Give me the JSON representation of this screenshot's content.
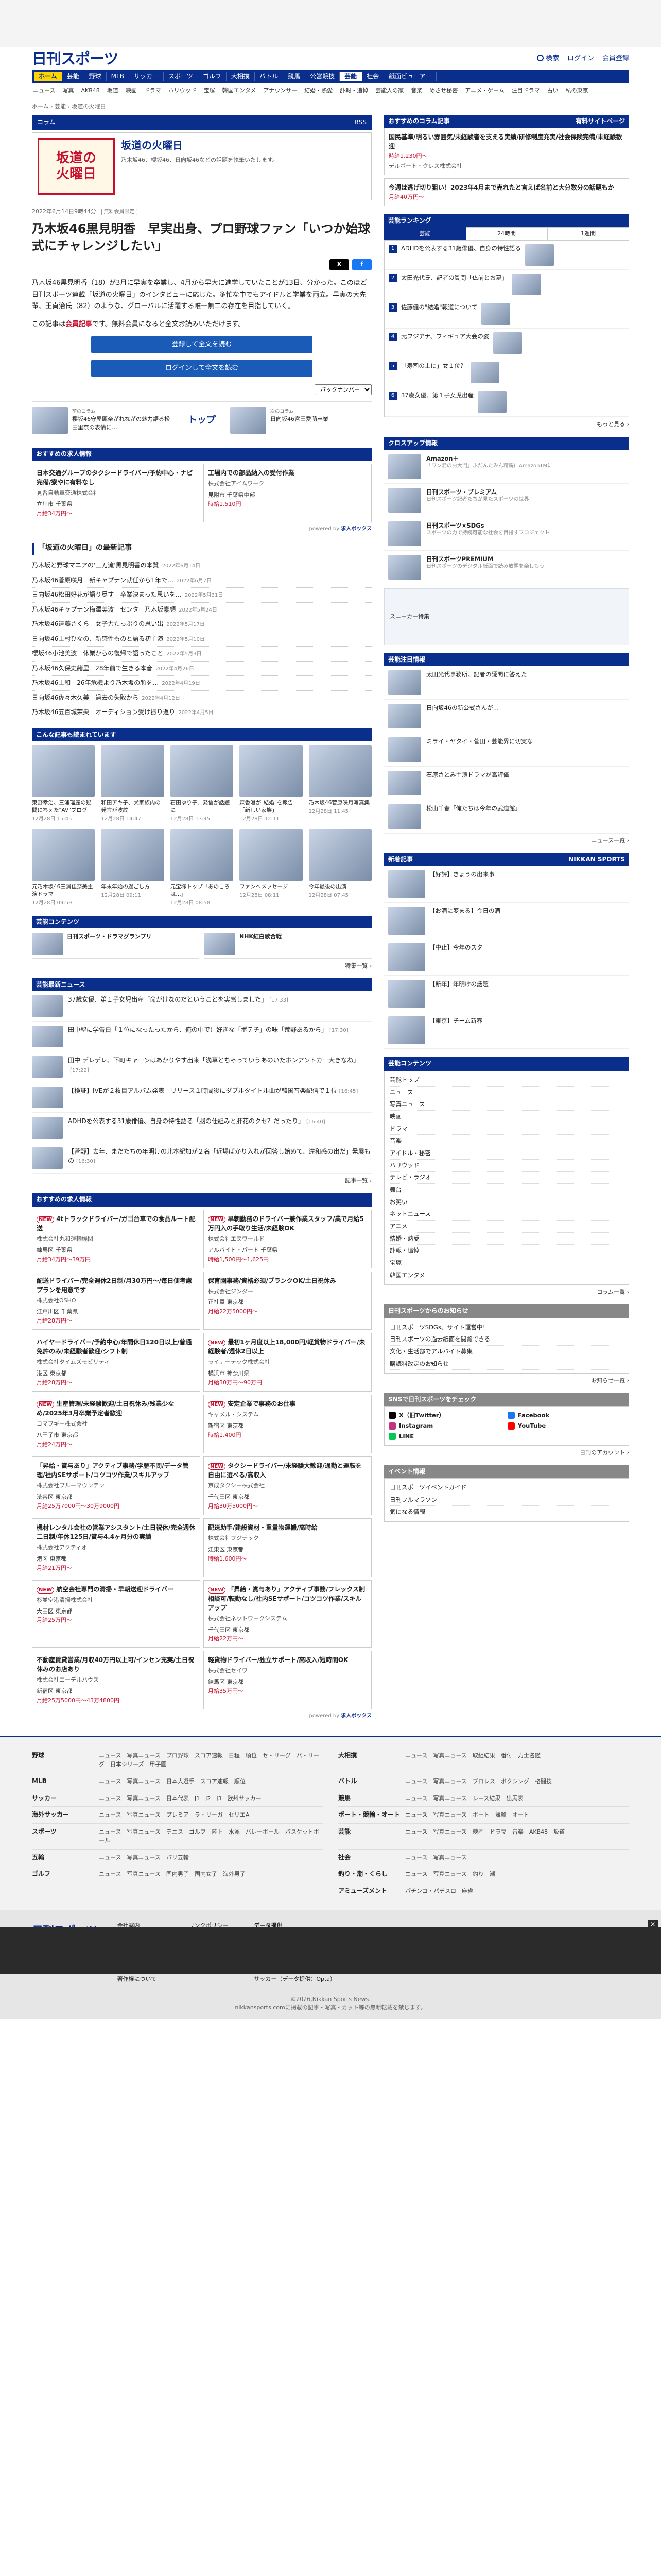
{
  "header": {
    "logo": "日刊スポーツ",
    "search": "検索",
    "login": "ログイン",
    "register": "会員登録"
  },
  "gnav": {
    "home": "ホーム",
    "items": [
      "芸能",
      "野球",
      "MLB",
      "サッカー",
      "スポーツ",
      "ゴルフ",
      "大相撲",
      "バトル",
      "競馬",
      "公営競技"
    ],
    "active": "芸能",
    "rest": [
      "社会",
      "紙面ビューアー"
    ]
  },
  "snav": [
    "ニュース",
    "写真",
    "AKB48",
    "坂道",
    "映画",
    "ドラマ",
    "ハリウッド",
    "宝塚",
    "韓国エンタメ",
    "アナウンサー",
    "結婚・熱愛",
    "訃報・追悼",
    "芸能人の家",
    "音楽",
    "めざせ秘密",
    "アニメ・ゲーム",
    "注目ドラマ",
    "占い",
    "私の東京"
  ],
  "breadcrumb": "ホーム › 芸能 › 坂道の火曜日",
  "column": {
    "tag": "コラム",
    "rss": "RSS",
    "logo_line1": "坂道の",
    "logo_line2": "火曜日",
    "title": "坂道の火曜日",
    "desc": "乃木坂46、櫻坂46、日向坂46などの話題を執筆いたします。"
  },
  "article": {
    "date": "2022年6月14日9時44分",
    "badge": "無料会員限定",
    "title": "乃木坂46黒見明香　早実出身、プロ野球ファン「いつか始球式にチャレンジしたい」",
    "body": "乃木坂46黒見明香（18）が3月に早実を卒業し、4月から早大に進学していたことが13日、分かった。このほど日刊スポーツ連載「坂道の火曜日」のインタビューに応じた。多忙な中でもアイドルと学業を両立。早実の大先輩、王貞治氏（82）のような、グローバルに活躍する唯一無二の存在を目指していく。",
    "note_pre": "この記事は",
    "note_strong": "会員記事",
    "note_post": "です。無料会員になると全文お読みいただけます。",
    "btn_register": "登録して全文を読む",
    "btn_login": "ログインして全文を読む",
    "backnum": "バックナンバー"
  },
  "share": {
    "x": "X",
    "fb": "f"
  },
  "pager": {
    "prev_label": "前のコラム",
    "prev_title": "櫻坂46守屋麗奈がれながの魅力語る松田里奈の表情に…",
    "top": "トップ",
    "next_label": "次のコラム",
    "next_title": "日向坂46宮田愛萌卒業"
  },
  "jobs_title": "おすすめの求人情報",
  "jobs_top": [
    {
      "title": "日本交通グループのタクシードライバー/予約中心・ナビ完備/寮やに有料なし",
      "company": "見習自動車交通株式会社",
      "loc": "立川市 千葉県",
      "pay": "月給34万円～"
    },
    {
      "title": "工場内での部品納入の受付作業",
      "company": "株式会社アイムワーク",
      "loc": "見附市 千葉県中部",
      "pay": "時給1,510円"
    }
  ],
  "latest_title": "「坂道の火曜日」の最新記事",
  "latest": [
    {
      "t": "乃木坂と野球マニアの'三刀流'黒見明香の本質",
      "d": "2022年6月14日"
    },
    {
      "t": "乃木坂46菅原咲月　新キャプテン就任から1年で…",
      "d": "2022年6月7日"
    },
    {
      "t": "日向坂46松田好花が語り尽す　卒業決まった思いを…",
      "d": "2022年5月31日"
    },
    {
      "t": "乃木坂46キャプテン梅澤美波　センター乃木坂素顔",
      "d": "2022年5月24日"
    },
    {
      "t": "乃木坂46遠藤さくら　女子力たっぷりの思い出",
      "d": "2022年5月17日"
    },
    {
      "t": "日向坂46上村ひなの、新感性ものと語る初主演",
      "d": "2022年5月10日"
    },
    {
      "t": "櫻坂46小池美波　休業からの復帰で語ったこと",
      "d": "2022年5月3日"
    },
    {
      "t": "乃木坂46久保史緒里　28年前で生きる本音",
      "d": "2022年4月26日"
    },
    {
      "t": "乃木坂46上和　26年危機より乃木坂の顔を…",
      "d": "2022年4月19日"
    },
    {
      "t": "日向坂46佐々木久美　過去の失敗から",
      "d": "2022年4月12日"
    },
    {
      "t": "乃木坂46五百城茉央　オーディション受け振り返り",
      "d": "2022年4月5日"
    }
  ],
  "photos_title": "こんな記事も読まれています",
  "photos": [
    {
      "t": "東野幸治、三浦瑠麗の疑問に答えた\"AV\"ブログ",
      "d": "12月28日 15:45"
    },
    {
      "t": "和田アキ子、犬家族内の発言が波紋",
      "d": "12月28日 14:47"
    },
    {
      "t": "石田ゆり子、発信が話題に",
      "d": "12月28日 13:45"
    },
    {
      "t": "森香澄が\"結婚\"を報告「新しい家族」",
      "d": "12月28日 12:11"
    },
    {
      "t": "乃木坂46菅原咲月写真集",
      "d": "12月28日 11:45"
    },
    {
      "t": "元乃木坂46三浦佳奈美主演ドラマ",
      "d": "12月28日 09:59"
    },
    {
      "t": "年末年始の過ごし方",
      "d": "12月28日 09:11"
    },
    {
      "t": "元宝塚トップ「あのころは…」",
      "d": "12月28日 08:58"
    },
    {
      "t": "ファンへメッセージ",
      "d": "12月28日 08:11"
    },
    {
      "t": "今年最後の出演",
      "d": "12月28日 07:45"
    }
  ],
  "special": {
    "title": "芸能コンテンツ",
    "a": "日刊スポーツ・ドラマグランプリ",
    "b": "NHK紅白歌合戦",
    "more": "特集一覧 ›"
  },
  "news_title": "芸能最新ニュース",
  "news": [
    {
      "t": "37歳女優、第１子女児出産「命がけなのだということを実感しました」",
      "tm": "[17:33]"
    },
    {
      "t": "田中聖に学告白「１位になったったから、俺の中で）好きな「ポテチ」の味「荒野あるから」",
      "tm": "[17:30]"
    },
    {
      "t": "田中 デレデレ、下町キャーンはあかりやす出来「浅草とちゃっていうあのいたホンアントカー大きなね」",
      "tm": "[17:22]"
    },
    {
      "t": "【検証】IVEが２枚目アルバム発表　リリース１時間後にダブルタイトル曲が韓国音楽配信で１位",
      "tm": "[16:45]"
    },
    {
      "t": "ADHDを公表する31歳俳優、自身の特性語る「脳の仕組みと肝花のクセ？だったり」",
      "tm": "[16:40]"
    },
    {
      "t": "【菅野】去年、まだたちの年明けの北本紀加が２名「近場ばかり入れが回答し始めて、違和感の出だ」発展もの",
      "tm": "[16:30]"
    }
  ],
  "news_more": "記事一覧 ›",
  "jobs_bottom": [
    {
      "new": true,
      "title": "4tトラックドライバー/ガゴ台車での食品ルート配送",
      "company": "株式会社丸和運輸機関",
      "loc": "練馬区 千葉県",
      "pay": "月給34万円～39万円"
    },
    {
      "new": true,
      "title": "早朝勤務のドライバー兼作業スタッフ/業で月給5万円入の手取り生活/未経験OK",
      "company": "株式会社エヌワールド",
      "loc": "アルバイト・パート 千葉県",
      "pay": "時給1,500円～1,625円"
    },
    {
      "new": false,
      "title": "配送ドライバー/完全週休2日制/月30万円～/毎日便考慮プランを用意です",
      "company": "株式会社OSHO",
      "loc": "江戸川区 千葉県",
      "pay": "月給28万円～"
    },
    {
      "new": false,
      "title": "保育園事務/資格必須/ブランクOK/土日祝休み",
      "company": "株式会社ジンダー",
      "loc": "正社員 東京都",
      "pay": "月給22万5000円～"
    },
    {
      "new": false,
      "title": "ハイヤードライバー/予約中心/年間休日120日以上/普通免許のみ/未経験者歓迎/シフト制",
      "company": "株式会社タイムズモビリティ",
      "loc": "港区 東京都",
      "pay": "月給28万円～"
    },
    {
      "new": true,
      "title": "最初1ヶ月度以上18,000円/軽貨物ドライバー/未経験者/週休2日以上",
      "company": "ライナーテック株式会社",
      "loc": "横浜市 神奈川県",
      "pay": "月給30万円～90万円"
    },
    {
      "new": true,
      "title": "生産管理/未経験歓迎/土日祝休み/残業少なめ/2025年3月卒業予定者歓迎",
      "company": "コマブギー株式会社",
      "loc": "八王子市 東京都",
      "pay": "月給24万円～"
    },
    {
      "new": true,
      "title": "安定企業で事務のお仕事",
      "company": "キャメル・システム",
      "loc": "新宿区 東京都",
      "pay": "時給1,400円"
    },
    {
      "new": false,
      "title": "「昇給・賞与あり」アクティブ事務/学歴不問/データ管理/社内SEサポート/コツコツ作業/スキルアップ",
      "company": "株式会社ブルーマウンテン",
      "loc": "渋谷区 東京都",
      "pay": "月給25万7000円～30万9000円"
    },
    {
      "new": true,
      "title": "タクシードライバー/未経験大歓迎/通勤と運転を自由に選べる/高収入",
      "company": "京成タクシー株式会社",
      "loc": "千代田区 東京都",
      "pay": "月給30万5000円～"
    },
    {
      "new": false,
      "title": "機材レンタル会社の営業アシスタント/土日祝休/完全週休二日制/年休125日/賞与4.4ヶ月分の実績",
      "company": "株式会社アクティオ",
      "loc": "港区 東京都",
      "pay": "月給21万円～"
    },
    {
      "new": false,
      "title": "配送助手/建設資材・重量物運搬/高時給",
      "company": "株式会社フジテック",
      "loc": "江東区 東京都",
      "pay": "時給1,600円～"
    },
    {
      "new": true,
      "title": "航空会社専門の清掃・早朝送迎ドライバー",
      "company": "杉並空港清掃株式会社",
      "loc": "大田区 東京都",
      "pay": "月給25万円～"
    },
    {
      "new": true,
      "title": "「昇給・賞与あり」アクティブ事務/フレックス制相談可/転勤なし/社内SEサポート/コツコツ作業/スキルアップ",
      "company": "株式会社ネットワークシステム",
      "loc": "千代田区 東京都",
      "pay": "月給22万円～"
    },
    {
      "new": false,
      "title": "不動産賃貸営業/月収40万円以上可/インセン充実/土日祝休みのお店あり",
      "company": "株式会社エーデルハウス",
      "loc": "新宿区 東京都",
      "pay": "月給25万5000円～43万4800円"
    },
    {
      "new": false,
      "title": "軽貨物ドライバー/独立サポート/高収入/短時間OK",
      "company": "株式会社セイワ",
      "loc": "練馬区 東京都",
      "pay": "月給35万円～"
    }
  ],
  "side": {
    "col_head": "おすすめのコラム記事",
    "ranking_btn": "有料サイトページ",
    "promo": {
      "t": "国民基準/明るい雰囲気/未経験者を支える実績/研修制度充実/社会保険完備/未経験歓迎",
      "price": "時給1,230円～",
      "co": "デルポート・クレス株式会社"
    },
    "promo2": {
      "t": "今週は逃げ切り狙い！2023年4月まで売れたと言えば名前と大分数分の話題もか",
      "price": "月給40万円～"
    },
    "rank_head": "芸能ランキング",
    "rank_tabs": [
      "芸能",
      "24時間",
      "1週間"
    ],
    "rank": [
      "ADHDを公表する31歳俳優、自身の特性語る",
      "太田光代氏、記者の質問「仏前とお墓」",
      "佐藤健の\"結婚\"報道について",
      "元フジアナ、フィギュア大会の姿",
      "「寿司の上に」女１位？",
      "37歳女優、第１子女児出産"
    ],
    "rank_more": "もっと見る ›",
    "cross_head": "クロスアップ情報",
    "cross": [
      {
        "t": "Amazon＋",
        "s": "「ワン君のお大門」ふだんたみん精鋭にAmazonTMに"
      },
      {
        "t": "日刊スポーツ・プレミアム",
        "s": "日刊スポーツ記者たちが見たスポーツの世界"
      },
      {
        "t": "日刊スポーツ×SDGs",
        "s": "スポーツの力で持続可能な社会を目指すプロジェクト"
      },
      {
        "t": "日刊スポーツPREMIUM",
        "s": "日刊スポーツのデジタル紙面で読み放題を楽しもう"
      }
    ],
    "shoes": "スニーカー特集",
    "topic_head": "芸能注目情報",
    "topics": [
      "太田光代事務所、記者の疑問に答えた",
      "日向坂46の新公式さんが…",
      "ミライ・ヤタイ・菅田・芸能界に切実な",
      "石原さとみ主演ドラマが高評価",
      "松山千春「俺たちは今年の武道館」"
    ],
    "topic_more": "ニュース一覧 ›",
    "np_head": "新着記事",
    "np": [
      "【好評】きょうの出来事",
      "【お酒に変まる】今日の酒",
      "【中止】今年のスター",
      "【新年】年明けの話題",
      "【東京】チーム新春"
    ],
    "index_head": "芸能コンテンツ",
    "index": [
      "芸能トップ",
      "ニュース",
      "写真ニュース",
      "映画",
      "ドラマ",
      "音楽",
      "アイドル・秘密",
      "ハリウッド",
      "テレビ・ラジオ",
      "舞台",
      "お笑い",
      "ネットニュース",
      "アニメ",
      "結婚・熱愛",
      "訃報・追悼",
      "宝塚",
      "韓国エンタメ"
    ],
    "index_more": "コラム一覧 ›",
    "site_head": "日刊スポーツからのお知らせ",
    "site": [
      "日刊スポーツSDGs、サイト運営中！",
      "日刊スポーツの過去紙面を閲覧できる",
      "文化・生活部でアルバイト募集",
      "購読料改定のお知らせ"
    ],
    "site_more": "お知らせ一覧 ›",
    "sns_head": "SNSで日刊スポーツをチェック",
    "sns": [
      "X（旧Twitter）",
      "Facebook",
      "Instagram",
      "YouTube",
      "LINE"
    ],
    "sns_more": "日刊のアカウント ›",
    "event_head": "イベント情報",
    "events": [
      "日刊スポーツイベントガイド",
      "日刊フルマラソン",
      "気になる情報"
    ]
  },
  "footer": {
    "rows": [
      {
        "k": "野球",
        "v": "ニュース　写真ニュース　プロ野球　スコア速報　日程　順位　セ・リーグ　パ・リーグ　日本シリーズ　甲子園"
      },
      {
        "k": "大相撲",
        "v": "ニュース　写真ニュース　取組結果　番付　力士名鑑"
      },
      {
        "k": "MLB",
        "v": "ニュース　写真ニュース　日本人選手　スコア速報　順位"
      },
      {
        "k": "バトル",
        "v": "ニュース　写真ニュース　プロレス　ボクシング　格闘技"
      },
      {
        "k": "サッカー",
        "v": "ニュース　写真ニュース　日本代表　J1　J2　J3　欧州サッカー"
      },
      {
        "k": "競馬",
        "v": "ニュース　写真ニュース　レース結果　出馬表"
      },
      {
        "k": "海外サッカー",
        "v": "ニュース　写真ニュース　プレミア　ラ・リーガ　セリエA"
      },
      {
        "k": "ボート・競輪・オート",
        "v": "ニュース　写真ニュース　ボート　競輪　オート"
      },
      {
        "k": "スポーツ",
        "v": "ニュース　写真ニュース　テニス　ゴルフ　陸上　水泳　バレーボール　バスケットボール"
      },
      {
        "k": "芸能",
        "v": "ニュース　写真ニュース　映画　ドラマ　音楽　AKB48　坂道"
      },
      {
        "k": "五輪",
        "v": "ニュース　写真ニュース　パリ五輪"
      },
      {
        "k": "社会",
        "v": "ニュース　写真ニュース"
      },
      {
        "k": "ゴルフ",
        "v": "ニュース　写真ニュース　国内男子　国内女子　海外男子"
      },
      {
        "k": "釣り・潮・くらし",
        "v": "ニュース　写真ニュース　釣り　潮"
      },
      {
        "k": "",
        "v": ""
      },
      {
        "k": "アミューズメント",
        "v": "パチンコ・パチスロ　麻雀"
      }
    ],
    "links1": [
      "会社案内",
      "採用情報",
      "広告ガイド",
      "サイトポリシー",
      "個人情報の取り扱い",
      "著作権について"
    ],
    "links2": [
      "リンクポリシー",
      "よくある質問",
      "新聞購読",
      "お問い合わせ",
      "アクセシビリティ"
    ],
    "data_head": "データ提供",
    "data": [
      "日本プロ野球(NPB)：IBM　データ",
      "MLB　©：データスタジアム",
      "Jリーグ：データスタジアム",
      "アイティメディア(ITmedia)",
      "サッカー（データ提供：Opta）"
    ],
    "copyright": "©2026,Nikkan Sports News.",
    "copy_note": "nikkansports.comに掲載の記事・写真・カット等の無断転載を禁じます。"
  }
}
